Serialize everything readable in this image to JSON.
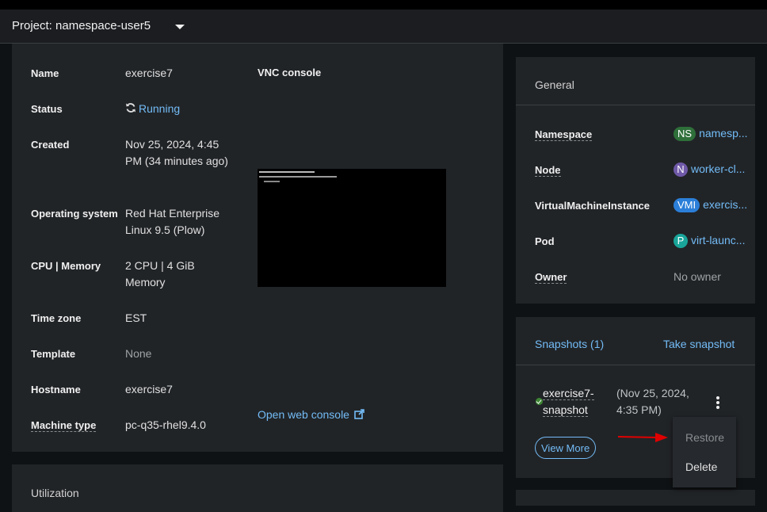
{
  "project": {
    "label": "Project: namespace-user5"
  },
  "details": {
    "rows": [
      {
        "label": "Name",
        "value": "exercise7"
      },
      {
        "label": "Status",
        "value": "Running"
      },
      {
        "label": "Created",
        "value": "Nov 25, 2024, 4:45 PM (34 minutes ago)"
      },
      {
        "label": "Operating system",
        "value": "Red Hat Enterprise Linux 9.5 (Plow)"
      },
      {
        "label": "CPU | Memory",
        "value": "2 CPU | 4 GiB Memory"
      },
      {
        "label": "Time zone",
        "value": "EST"
      },
      {
        "label": "Template",
        "value": "None"
      },
      {
        "label": "Hostname",
        "value": "exercise7"
      },
      {
        "label": "Machine type",
        "value": "pc-q35-rhel9.4.0"
      }
    ],
    "vnc_title": "VNC console",
    "open_console": "Open web console"
  },
  "utilization": {
    "title": "Utilization"
  },
  "general": {
    "title": "General",
    "rows": [
      {
        "label": "Namespace",
        "badge": "NS",
        "value": "namesp..."
      },
      {
        "label": "Node",
        "badge": "N",
        "value": "worker-cl..."
      },
      {
        "label": "VirtualMachineInstance",
        "badge": "VMI",
        "value": "exercis..."
      },
      {
        "label": "Pod",
        "badge": "P",
        "value": "virt-launc..."
      },
      {
        "label": "Owner",
        "value": "No owner"
      }
    ]
  },
  "snapshots": {
    "title": "Snapshots (1)",
    "take": "Take snapshot",
    "item": {
      "name": "exercise7-snapshot",
      "date": "(Nov 25, 2024, 4:35 PM)"
    },
    "view_more": "View More"
  },
  "menu": {
    "restore": "Restore",
    "delete": "Delete"
  },
  "colors": {
    "link": "#73bcf7",
    "success": "#3e8635",
    "arrow": "#e00000"
  }
}
